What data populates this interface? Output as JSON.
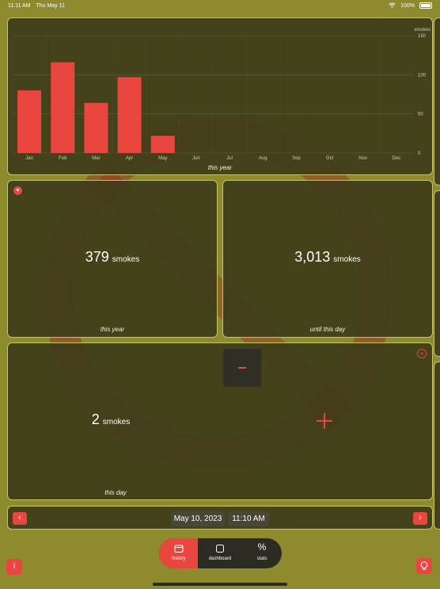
{
  "status_bar": {
    "time": "11:11 AM",
    "date": "Thu May 11",
    "wifi_icon": "wifi-icon",
    "battery": "100%"
  },
  "chart_data": {
    "type": "bar",
    "categories": [
      "Jan",
      "Feb",
      "Mar",
      "Apr",
      "May",
      "Jun",
      "Jul",
      "Aug",
      "Sep",
      "Oct",
      "Nov",
      "Dec"
    ],
    "values": [
      80,
      116,
      64,
      97,
      22,
      0,
      0,
      0,
      0,
      0,
      0,
      0
    ],
    "ylabel": "smokes",
    "yticks": [
      0,
      50,
      100,
      150
    ],
    "ylim": [
      0,
      150
    ],
    "caption": "this year",
    "bar_color": "#e8463f",
    "grid": true
  },
  "cards": {
    "year": {
      "value": "379",
      "unit": "smokes",
      "caption": "this year",
      "heart_icon": "heart-icon"
    },
    "total": {
      "value": "3,013",
      "unit": "smokes",
      "caption": "until this day"
    },
    "day": {
      "value": "2",
      "unit": "smokes",
      "caption": "this day",
      "minus_icon": "minus-icon",
      "plus_icon": "plus-icon",
      "close_icon": "close-circle-icon"
    }
  },
  "date_nav": {
    "prev_label": "‹",
    "date": "May 10, 2023",
    "time": "11:10 AM",
    "next_label": "›"
  },
  "tabs": [
    {
      "label": "history",
      "icon": "calendar-icon",
      "active": true
    },
    {
      "label": "dashboard",
      "icon": "square-icon",
      "active": false
    },
    {
      "label": "stats",
      "icon": "percent-icon",
      "active": false
    }
  ],
  "corner_buttons": {
    "info_label": "i",
    "info_icon": "info-icon",
    "tip_icon": "lightbulb-icon"
  },
  "colors": {
    "accent": "#e8463f",
    "background": "#8e8b2e",
    "panel": "#3e3c1a",
    "border": "#c7c467"
  }
}
